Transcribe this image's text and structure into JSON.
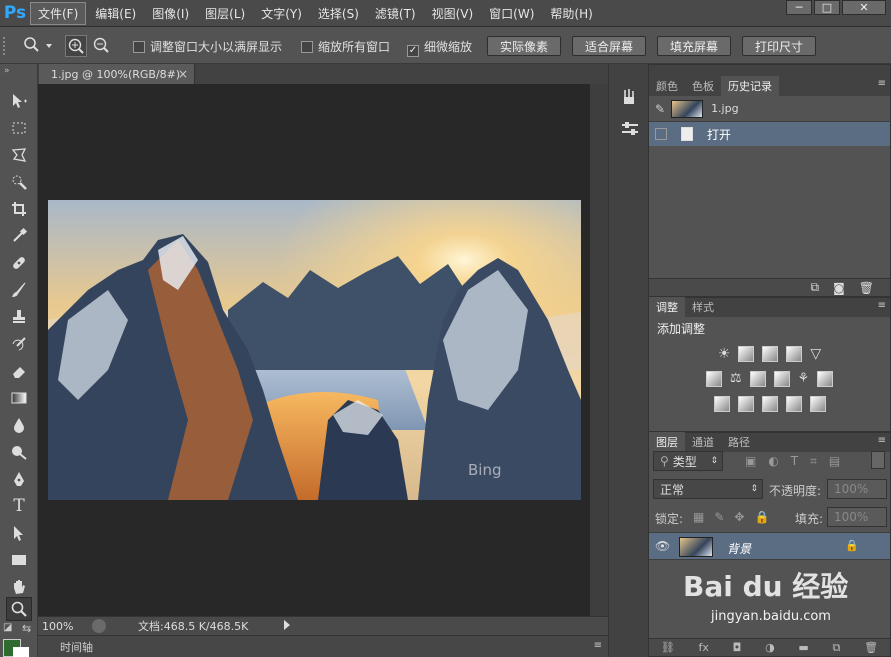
{
  "app": {
    "logo": "Ps"
  },
  "menubar": {
    "items": [
      "文件(F)",
      "编辑(E)",
      "图像(I)",
      "图层(L)",
      "文字(Y)",
      "选择(S)",
      "滤镜(T)",
      "视图(V)",
      "窗口(W)",
      "帮助(H)"
    ],
    "window_buttons": [
      "─",
      "□",
      "✕"
    ]
  },
  "options": {
    "resize_windows": {
      "label": "调整窗口大小以满屏显示",
      "checked": false
    },
    "zoom_all": {
      "label": "缩放所有窗口",
      "checked": false
    },
    "scrubby_zoom": {
      "label": "细微缩放",
      "checked": true
    },
    "buttons": [
      "实际像素",
      "适合屏幕",
      "填充屏幕",
      "打印尺寸"
    ]
  },
  "document": {
    "tab_title": "1.jpg @ 100%(RGB/8#)",
    "tab_close": "×",
    "watermark": "Bing"
  },
  "status": {
    "zoom": "100%",
    "doc_info": "文档:468.5 K/468.5K"
  },
  "timeline": {
    "label": "时间轴"
  },
  "history_panel": {
    "tabs": [
      "颜色",
      "色板",
      "历史记录"
    ],
    "active_tab": "历史记录",
    "snapshot_name": "1.jpg",
    "entries": [
      "打开"
    ]
  },
  "adjustments_panel": {
    "tabs": [
      "调整",
      "样式"
    ],
    "heading": "添加调整"
  },
  "layers_panel": {
    "tabs": [
      "图层",
      "通道",
      "路径"
    ],
    "filter_kind": "类型",
    "blend_mode": "正常",
    "opacity_label": "不透明度:",
    "opacity_value": "100%",
    "lock_label": "锁定:",
    "fill_label": "填充:",
    "fill_value": "100%",
    "layers": [
      {
        "name": "背景",
        "visible": true,
        "locked": true
      }
    ],
    "bottom_icons": [
      "link-icon",
      "fx-icon",
      "mask-icon",
      "adjustment-icon",
      "folder-icon",
      "new-layer-icon",
      "trash-icon"
    ]
  },
  "watermark_site": {
    "brand": "Bai du 经验",
    "url": "jingyan.baidu.com"
  },
  "colors": {
    "accent_blue": "#31a8ff",
    "panel_bg": "#535353",
    "canvas_bg": "#282828",
    "selected_row": "#5b6d83",
    "foreground_swatch": "#2f6b2f",
    "background_swatch": "#ffffff"
  }
}
